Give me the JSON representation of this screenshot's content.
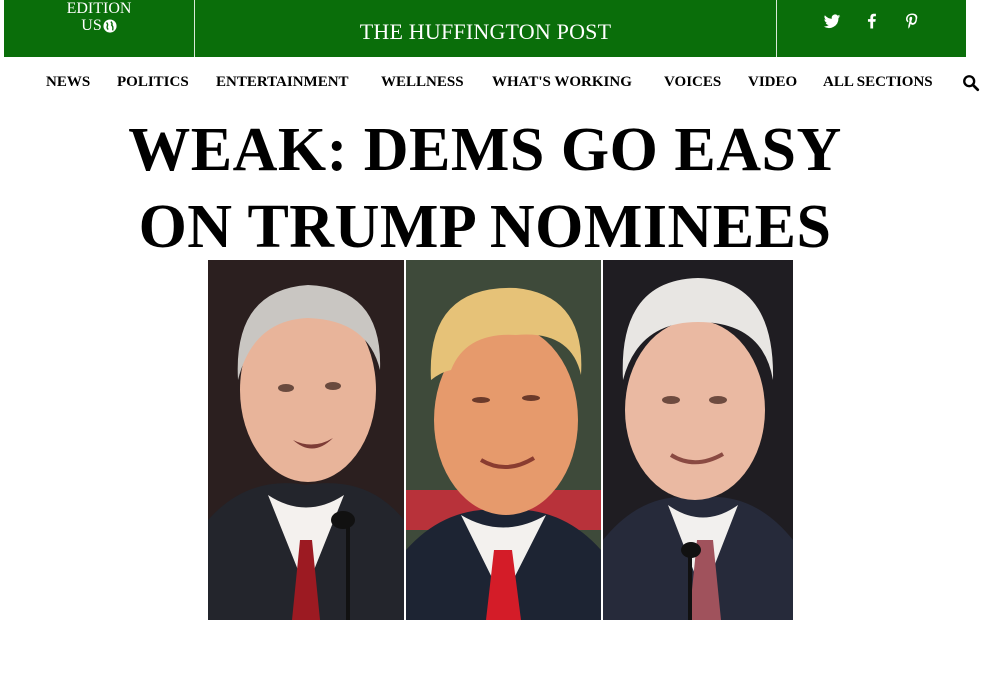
{
  "header": {
    "edition_label": "EDITION",
    "edition_region": "US",
    "brand": "THE HUFFINGTON POST",
    "bar_color": "#0a6e0a",
    "social_icons": [
      "twitter-icon",
      "facebook-icon",
      "pinterest-icon"
    ]
  },
  "nav": {
    "items": [
      "NEWS",
      "POLITICS",
      "ENTERTAINMENT",
      "WELLNESS",
      "WHAT'S WORKING",
      "VOICES",
      "VIDEO",
      "ALL SECTIONS"
    ],
    "search_icon": "search-icon"
  },
  "headline": {
    "line1": "WEAK: DEMS GO EASY",
    "line2": "ON TRUMP NOMINEES"
  },
  "photos": [
    "left-portrait",
    "center-portrait",
    "right-portrait"
  ]
}
